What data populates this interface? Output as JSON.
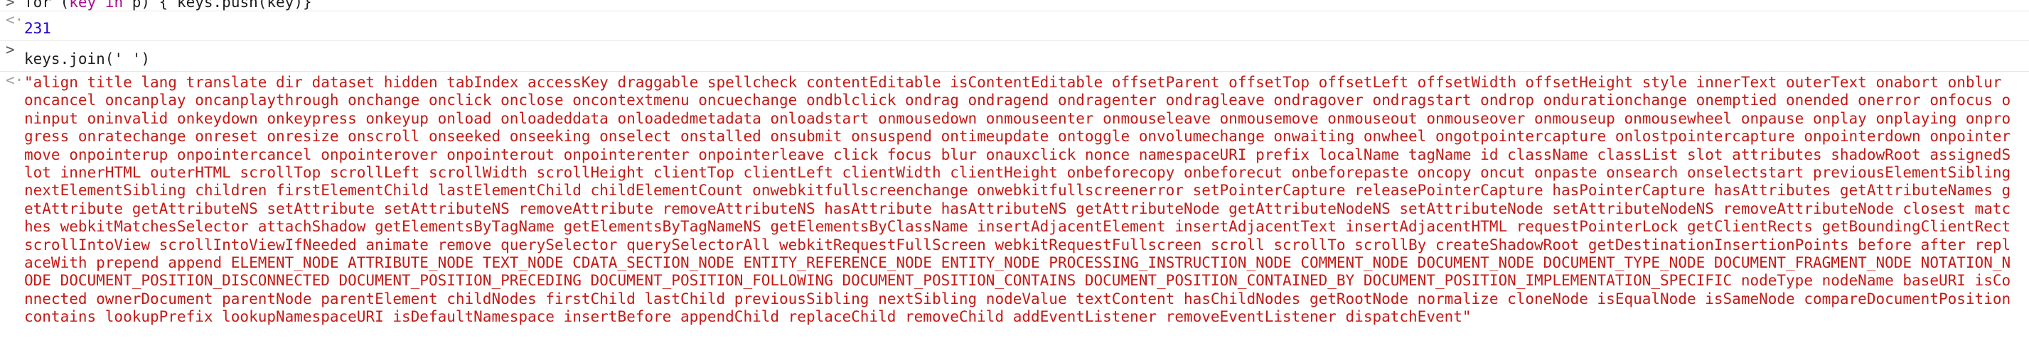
{
  "console": {
    "input_1": {
      "before_kw_1": "for (",
      "kw_key": "key",
      "space": " ",
      "kw_in": "in",
      "after_kw": " p) { keys.push(key)}"
    },
    "result_1": "231",
    "input_2": "keys.join(' ')",
    "result_2": "\"align title lang translate dir dataset hidden tabIndex accessKey draggable spellcheck contentEditable isContentEditable offsetParent offsetTop offsetLeft offsetWidth offsetHeight style innerText outerText onabort onblur oncancel oncanplay oncanplaythrough onchange onclick onclose oncontextmenu oncuechange ondblclick ondrag ondragend ondragenter ondragleave ondragover ondragstart ondrop ondurationchange onemptied onended onerror onfocus oninput oninvalid onkeydown onkeypress onkeyup onload onloadeddata onloadedmetadata onloadstart onmousedown onmouseenter onmouseleave onmousemove onmouseout onmouseover onmouseup onmousewheel onpause onplay onplaying onprogress onratechange onreset onresize onscroll onseeked onseeking onselect onstalled onsubmit onsuspend ontimeupdate ontoggle onvolumechange onwaiting onwheel ongotpointercapture onlostpointercapture onpointerdown onpointermove onpointerup onpointercancel onpointerover onpointerout onpointerenter onpointerleave click focus blur onauxclick nonce namespaceURI prefix localName tagName id className classList slot attributes shadowRoot assignedSlot innerHTML outerHTML scrollTop scrollLeft scrollWidth scrollHeight clientTop clientLeft clientWidth clientHeight onbeforecopy onbeforecut onbeforepaste oncopy oncut onpaste onsearch onselectstart previousElementSibling nextElementSibling children firstElementChild lastElementChild childElementCount onwebkitfullscreenchange onwebkitfullscreenerror setPointerCapture releasePointerCapture hasPointerCapture hasAttributes getAttributeNames getAttribute getAttributeNS setAttribute setAttributeNS removeAttribute removeAttributeNS hasAttribute hasAttributeNS getAttributeNode getAttributeNodeNS setAttributeNode setAttributeNodeNS removeAttributeNode closest matches webkitMatchesSelector attachShadow getElementsByTagName getElementsByTagNameNS getElementsByClassName insertAdjacentElement insertAdjacentText insertAdjacentHTML requestPointerLock getClientRects getBoundingClientRect scrollIntoView scrollIntoViewIfNeeded animate remove querySelector querySelectorAll webkitRequestFullScreen webkitRequestFullscreen scroll scrollTo scrollBy createShadowRoot getDestinationInsertionPoints before after replaceWith prepend append ELEMENT_NODE ATTRIBUTE_NODE TEXT_NODE CDATA_SECTION_NODE ENTITY_REFERENCE_NODE ENTITY_NODE PROCESSING_INSTRUCTION_NODE COMMENT_NODE DOCUMENT_NODE DOCUMENT_TYPE_NODE DOCUMENT_FRAGMENT_NODE NOTATION_NODE DOCUMENT_POSITION_DISCONNECTED DOCUMENT_POSITION_PRECEDING DOCUMENT_POSITION_FOLLOWING DOCUMENT_POSITION_CONTAINS DOCUMENT_POSITION_CONTAINED_BY DOCUMENT_POSITION_IMPLEMENTATION_SPECIFIC nodeType nodeName baseURI isConnected ownerDocument parentNode parentElement childNodes firstChild lastChild previousSibling nextSibling nodeValue textContent hasChildNodes getRootNode normalize cloneNode isEqualNode isSameNode compareDocumentPosition contains lookupPrefix lookupNamespaceURI isDefaultNamespace insertBefore appendChild replaceChild removeChild addEventListener removeEventListener dispatchEvent\"",
    "input_prompt": ">",
    "result_prompt": "<·",
    "colors": {
      "keyword": "#aa0d91",
      "number": "#1c00cf",
      "string": "#c41a16",
      "text": "#1e1e1e",
      "separator": "#e6e6e6"
    }
  }
}
